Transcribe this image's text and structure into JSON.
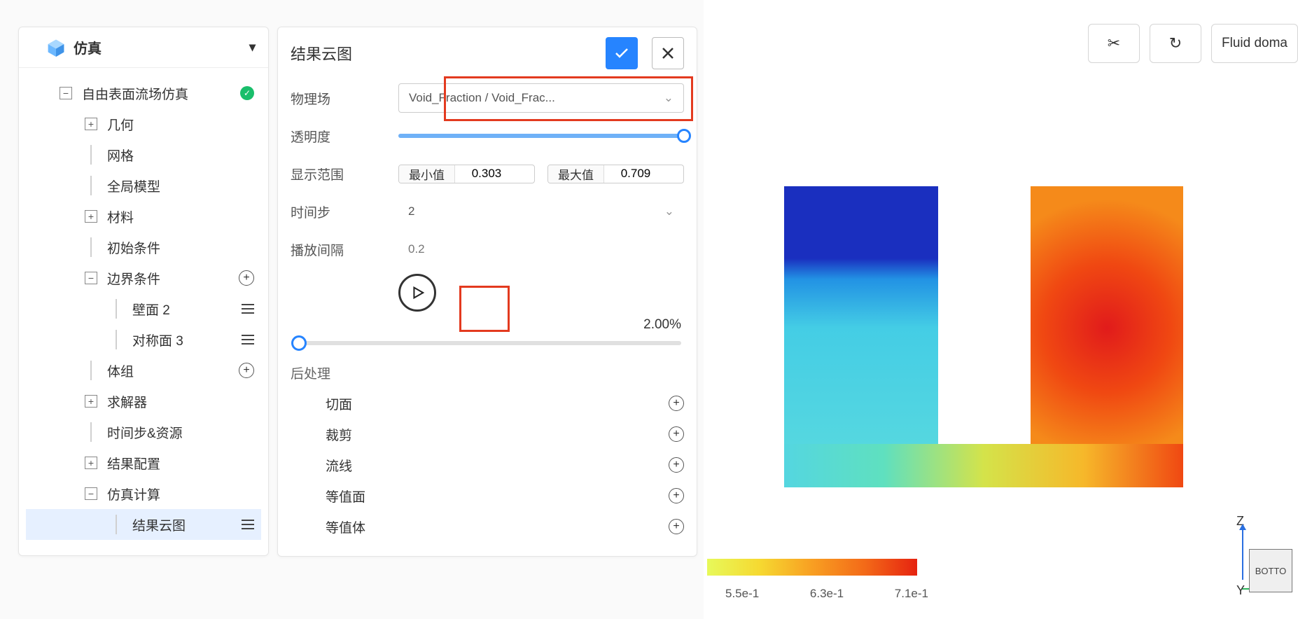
{
  "tree": {
    "header_label": "仿真",
    "root": "自由表面流场仿真",
    "nodes": {
      "geometry": "几何",
      "mesh": "网格",
      "global_model": "全局模型",
      "materials": "材料",
      "initial_cond": "初始条件",
      "boundary": "边界条件",
      "wall2": "壁面 2",
      "sym3": "对称面 3",
      "volume_group": "体组",
      "solver": "求解器",
      "timestep_res": "时间步&资源",
      "result_cfg": "结果配置",
      "sim_calc": "仿真计算",
      "cloud": "结果云图"
    }
  },
  "panel": {
    "title": "结果云图",
    "fields": {
      "physics_label": "物理场",
      "physics_value": "Void_Fraction / Void_Frac...",
      "opacity_label": "透明度",
      "range_label": "显示范围",
      "min_label": "最小值",
      "min_value": "0.303",
      "max_label": "最大值",
      "max_value": "0.709",
      "timestep_label": "时间步",
      "timestep_value": "2",
      "interval_label": "播放间隔",
      "interval_value": "0.2",
      "percent": "2.00%",
      "post_label": "后处理",
      "pp_items": [
        "切面",
        "裁剪",
        "流线",
        "等值面",
        "等值体"
      ]
    }
  },
  "toolbar": {
    "domain_btn": "Fluid doma"
  },
  "legend": {
    "ticks": [
      "5.5e-1",
      "6.3e-1",
      "7.1e-1"
    ]
  },
  "gizmo": {
    "face": "BOTTO",
    "z": "Z",
    "y": "Y"
  }
}
